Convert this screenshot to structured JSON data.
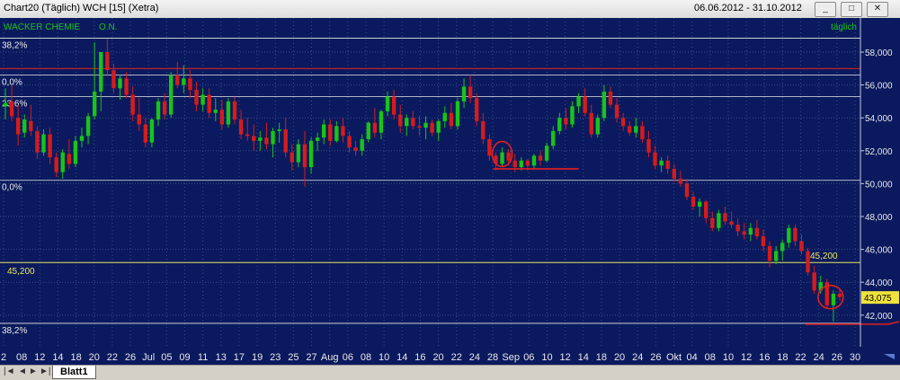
{
  "window": {
    "title": "Chart20 (Täglich)  WCH [15] (Xetra)",
    "date_range": "06.06.2012 - 31.10.2012"
  },
  "sheet_tab": "Blatt1",
  "colors": {
    "up": "#18c418",
    "down": "#d41c1c",
    "background": "#0b1a5e",
    "grid": "#3a4a8a",
    "fib": "#e8e8e8",
    "resistance": "#d42020",
    "support": "#e8e85a",
    "header_text": "#18c418"
  },
  "chart_data": {
    "type": "candlestick",
    "header_left": "WACKER CHEMIE",
    "header_mid": "O.N.",
    "header_right": "täglich",
    "ylim": [
      41.0,
      59.0
    ],
    "y_ticks": [
      "58,000",
      "56,000",
      "54,000",
      "52,000",
      "50,000",
      "48,000",
      "46,000",
      "44,000",
      "42,000"
    ],
    "last_price": "43,075",
    "x_labels": [
      "2",
      "08",
      "12",
      "14",
      "18",
      "20",
      "22",
      "26",
      "Jul",
      "05",
      "09",
      "11",
      "13",
      "17",
      "19",
      "23",
      "25",
      "27",
      "Aug",
      "06",
      "08",
      "10",
      "14",
      "16",
      "20",
      "22",
      "24",
      "28",
      "Sep",
      "06",
      "10",
      "12",
      "14",
      "18",
      "20",
      "24",
      "26",
      "Okt",
      "04",
      "08",
      "10",
      "12",
      "16",
      "18",
      "22",
      "24",
      "26",
      "30"
    ],
    "fib_lines": [
      {
        "value": 58.85,
        "label": "38,2%"
      },
      {
        "value": 56.6,
        "label": "0,0%"
      },
      {
        "value": 55.3,
        "label": "23,6%"
      },
      {
        "value": 50.2,
        "label": "0,0%"
      },
      {
        "value": 41.5,
        "label": "38,2%"
      }
    ],
    "resistance_line": 57.0,
    "support_line": {
      "value": 45.2,
      "label_left": "45,200",
      "label_right": "45,200"
    },
    "series": [
      {
        "o": 54.7,
        "h": 55.8,
        "l": 53.9,
        "c": 54.9
      },
      {
        "o": 55.0,
        "h": 56.0,
        "l": 53.8,
        "c": 54.1
      },
      {
        "o": 54.0,
        "h": 54.8,
        "l": 52.3,
        "c": 53.0
      },
      {
        "o": 53.1,
        "h": 54.2,
        "l": 52.8,
        "c": 53.9
      },
      {
        "o": 53.8,
        "h": 54.8,
        "l": 52.9,
        "c": 53.2
      },
      {
        "o": 53.2,
        "h": 53.5,
        "l": 51.5,
        "c": 51.9
      },
      {
        "o": 51.9,
        "h": 53.3,
        "l": 51.7,
        "c": 53.0
      },
      {
        "o": 53.0,
        "h": 53.4,
        "l": 51.2,
        "c": 51.6
      },
      {
        "o": 51.6,
        "h": 51.9,
        "l": 50.4,
        "c": 50.7
      },
      {
        "o": 50.7,
        "h": 52.1,
        "l": 50.3,
        "c": 51.9
      },
      {
        "o": 51.8,
        "h": 52.7,
        "l": 50.9,
        "c": 51.2
      },
      {
        "o": 51.2,
        "h": 52.9,
        "l": 51.0,
        "c": 52.6
      },
      {
        "o": 52.6,
        "h": 53.4,
        "l": 52.2,
        "c": 52.9
      },
      {
        "o": 52.9,
        "h": 54.3,
        "l": 52.4,
        "c": 54.1
      },
      {
        "o": 54.1,
        "h": 58.6,
        "l": 53.9,
        "c": 55.6
      },
      {
        "o": 55.6,
        "h": 58.0,
        "l": 54.4,
        "c": 58.0
      },
      {
        "o": 58.0,
        "h": 58.8,
        "l": 56.5,
        "c": 56.9
      },
      {
        "o": 56.9,
        "h": 57.3,
        "l": 55.5,
        "c": 55.8
      },
      {
        "o": 55.8,
        "h": 56.6,
        "l": 55.1,
        "c": 56.4
      },
      {
        "o": 56.4,
        "h": 56.8,
        "l": 55.2,
        "c": 55.4
      },
      {
        "o": 55.4,
        "h": 55.9,
        "l": 53.8,
        "c": 54.2
      },
      {
        "o": 54.2,
        "h": 55.2,
        "l": 53.2,
        "c": 53.6
      },
      {
        "o": 53.6,
        "h": 54.0,
        "l": 52.2,
        "c": 52.5
      },
      {
        "o": 52.5,
        "h": 54.0,
        "l": 52.2,
        "c": 53.9
      },
      {
        "o": 53.9,
        "h": 55.2,
        "l": 53.5,
        "c": 55.0
      },
      {
        "o": 55.0,
        "h": 55.5,
        "l": 53.9,
        "c": 54.2
      },
      {
        "o": 54.2,
        "h": 56.8,
        "l": 54.0,
        "c": 56.6
      },
      {
        "o": 56.6,
        "h": 57.4,
        "l": 55.8,
        "c": 56.0
      },
      {
        "o": 56.0,
        "h": 57.2,
        "l": 55.5,
        "c": 56.4
      },
      {
        "o": 56.4,
        "h": 56.9,
        "l": 55.2,
        "c": 55.7
      },
      {
        "o": 55.7,
        "h": 56.2,
        "l": 54.4,
        "c": 54.8
      },
      {
        "o": 54.8,
        "h": 55.8,
        "l": 54.4,
        "c": 55.4
      },
      {
        "o": 55.4,
        "h": 55.8,
        "l": 54.0,
        "c": 54.3
      },
      {
        "o": 54.3,
        "h": 55.2,
        "l": 53.8,
        "c": 54.5
      },
      {
        "o": 54.5,
        "h": 55.1,
        "l": 53.3,
        "c": 53.6
      },
      {
        "o": 53.6,
        "h": 55.2,
        "l": 53.4,
        "c": 55.0
      },
      {
        "o": 55.0,
        "h": 55.3,
        "l": 53.6,
        "c": 53.9
      },
      {
        "o": 53.9,
        "h": 54.5,
        "l": 52.7,
        "c": 53.0
      },
      {
        "o": 53.0,
        "h": 54.0,
        "l": 52.6,
        "c": 52.9
      },
      {
        "o": 52.9,
        "h": 53.6,
        "l": 52.0,
        "c": 52.6
      },
      {
        "o": 52.6,
        "h": 53.2,
        "l": 52.0,
        "c": 52.8
      },
      {
        "o": 52.8,
        "h": 53.7,
        "l": 52.1,
        "c": 52.4
      },
      {
        "o": 52.4,
        "h": 53.4,
        "l": 51.6,
        "c": 53.2
      },
      {
        "o": 53.2,
        "h": 53.7,
        "l": 52.5,
        "c": 53.3
      },
      {
        "o": 53.3,
        "h": 54.0,
        "l": 51.6,
        "c": 51.9
      },
      {
        "o": 51.9,
        "h": 52.4,
        "l": 50.8,
        "c": 51.3
      },
      {
        "o": 51.3,
        "h": 52.7,
        "l": 51.0,
        "c": 52.4
      },
      {
        "o": 52.4,
        "h": 53.2,
        "l": 49.8,
        "c": 51.0
      },
      {
        "o": 51.0,
        "h": 52.8,
        "l": 50.6,
        "c": 52.6
      },
      {
        "o": 52.6,
        "h": 53.1,
        "l": 52.0,
        "c": 52.8
      },
      {
        "o": 52.8,
        "h": 53.9,
        "l": 52.4,
        "c": 53.6
      },
      {
        "o": 53.6,
        "h": 53.9,
        "l": 52.3,
        "c": 52.6
      },
      {
        "o": 52.6,
        "h": 53.8,
        "l": 52.5,
        "c": 53.5
      },
      {
        "o": 53.5,
        "h": 54.0,
        "l": 52.5,
        "c": 52.9
      },
      {
        "o": 52.9,
        "h": 53.2,
        "l": 51.9,
        "c": 52.2
      },
      {
        "o": 52.2,
        "h": 52.6,
        "l": 51.7,
        "c": 52.0
      },
      {
        "o": 52.0,
        "h": 53.0,
        "l": 51.7,
        "c": 52.7
      },
      {
        "o": 52.7,
        "h": 53.8,
        "l": 52.5,
        "c": 53.7
      },
      {
        "o": 53.7,
        "h": 54.6,
        "l": 52.8,
        "c": 53.1
      },
      {
        "o": 53.1,
        "h": 54.5,
        "l": 52.7,
        "c": 54.4
      },
      {
        "o": 54.4,
        "h": 55.6,
        "l": 54.1,
        "c": 55.3
      },
      {
        "o": 55.3,
        "h": 55.7,
        "l": 53.9,
        "c": 54.2
      },
      {
        "o": 54.2,
        "h": 54.8,
        "l": 53.1,
        "c": 53.5
      },
      {
        "o": 53.5,
        "h": 54.2,
        "l": 52.9,
        "c": 54.0
      },
      {
        "o": 54.0,
        "h": 54.4,
        "l": 53.3,
        "c": 53.5
      },
      {
        "o": 53.5,
        "h": 54.1,
        "l": 52.9,
        "c": 53.4
      },
      {
        "o": 53.4,
        "h": 54.1,
        "l": 52.7,
        "c": 53.7
      },
      {
        "o": 53.7,
        "h": 53.9,
        "l": 52.9,
        "c": 53.1
      },
      {
        "o": 53.1,
        "h": 53.9,
        "l": 52.6,
        "c": 53.8
      },
      {
        "o": 53.8,
        "h": 54.7,
        "l": 53.4,
        "c": 54.3
      },
      {
        "o": 54.3,
        "h": 54.9,
        "l": 53.3,
        "c": 53.5
      },
      {
        "o": 53.5,
        "h": 55.2,
        "l": 53.3,
        "c": 55.0
      },
      {
        "o": 55.0,
        "h": 56.4,
        "l": 54.6,
        "c": 55.9
      },
      {
        "o": 55.9,
        "h": 56.6,
        "l": 54.9,
        "c": 55.2
      },
      {
        "o": 55.2,
        "h": 55.5,
        "l": 53.5,
        "c": 53.8
      },
      {
        "o": 53.8,
        "h": 54.3,
        "l": 52.4,
        "c": 52.7
      },
      {
        "o": 52.7,
        "h": 53.0,
        "l": 51.4,
        "c": 51.7
      },
      {
        "o": 51.7,
        "h": 51.9,
        "l": 50.8,
        "c": 51.2
      },
      {
        "o": 51.2,
        "h": 52.2,
        "l": 51.0,
        "c": 51.9
      },
      {
        "o": 51.9,
        "h": 52.1,
        "l": 51.1,
        "c": 51.4
      },
      {
        "o": 51.4,
        "h": 51.8,
        "l": 50.7,
        "c": 51.0
      },
      {
        "o": 51.0,
        "h": 51.6,
        "l": 50.8,
        "c": 51.4
      },
      {
        "o": 51.4,
        "h": 51.5,
        "l": 50.8,
        "c": 51.1
      },
      {
        "o": 51.1,
        "h": 51.8,
        "l": 50.9,
        "c": 51.7
      },
      {
        "o": 51.7,
        "h": 52.0,
        "l": 51.1,
        "c": 51.4
      },
      {
        "o": 51.4,
        "h": 52.5,
        "l": 51.3,
        "c": 52.3
      },
      {
        "o": 52.3,
        "h": 53.5,
        "l": 52.1,
        "c": 53.2
      },
      {
        "o": 53.2,
        "h": 54.3,
        "l": 53.0,
        "c": 54.0
      },
      {
        "o": 54.0,
        "h": 54.6,
        "l": 53.3,
        "c": 53.6
      },
      {
        "o": 53.6,
        "h": 55.0,
        "l": 53.4,
        "c": 54.7
      },
      {
        "o": 54.7,
        "h": 55.5,
        "l": 54.3,
        "c": 55.3
      },
      {
        "o": 55.3,
        "h": 55.8,
        "l": 54.1,
        "c": 54.3
      },
      {
        "o": 54.3,
        "h": 54.8,
        "l": 52.8,
        "c": 53.0
      },
      {
        "o": 53.0,
        "h": 54.2,
        "l": 52.8,
        "c": 54.0
      },
      {
        "o": 54.0,
        "h": 56.0,
        "l": 53.8,
        "c": 55.6
      },
      {
        "o": 55.6,
        "h": 55.9,
        "l": 54.6,
        "c": 54.8
      },
      {
        "o": 54.8,
        "h": 55.2,
        "l": 53.7,
        "c": 54.0
      },
      {
        "o": 54.0,
        "h": 54.3,
        "l": 53.2,
        "c": 53.5
      },
      {
        "o": 53.5,
        "h": 53.8,
        "l": 52.9,
        "c": 53.1
      },
      {
        "o": 53.1,
        "h": 54.0,
        "l": 52.8,
        "c": 53.5
      },
      {
        "o": 53.5,
        "h": 53.8,
        "l": 52.5,
        "c": 52.7
      },
      {
        "o": 52.7,
        "h": 53.2,
        "l": 51.6,
        "c": 51.9
      },
      {
        "o": 51.9,
        "h": 52.3,
        "l": 50.9,
        "c": 51.1
      },
      {
        "o": 51.1,
        "h": 51.6,
        "l": 50.7,
        "c": 51.4
      },
      {
        "o": 51.4,
        "h": 51.7,
        "l": 50.6,
        "c": 50.9
      },
      {
        "o": 50.9,
        "h": 51.2,
        "l": 50.1,
        "c": 50.3
      },
      {
        "o": 50.3,
        "h": 50.8,
        "l": 49.8,
        "c": 50.0
      },
      {
        "o": 50.0,
        "h": 50.3,
        "l": 49.0,
        "c": 49.2
      },
      {
        "o": 49.2,
        "h": 49.5,
        "l": 48.4,
        "c": 48.6
      },
      {
        "o": 48.6,
        "h": 49.1,
        "l": 48.0,
        "c": 48.9
      },
      {
        "o": 48.9,
        "h": 49.0,
        "l": 47.6,
        "c": 47.9
      },
      {
        "o": 47.9,
        "h": 48.3,
        "l": 47.1,
        "c": 47.3
      },
      {
        "o": 47.3,
        "h": 48.4,
        "l": 47.1,
        "c": 48.2
      },
      {
        "o": 48.2,
        "h": 48.6,
        "l": 47.5,
        "c": 47.7
      },
      {
        "o": 47.7,
        "h": 48.3,
        "l": 47.3,
        "c": 47.5
      },
      {
        "o": 47.5,
        "h": 47.9,
        "l": 46.8,
        "c": 47.1
      },
      {
        "o": 47.1,
        "h": 47.6,
        "l": 46.6,
        "c": 46.9
      },
      {
        "o": 46.9,
        "h": 47.6,
        "l": 46.5,
        "c": 47.3
      },
      {
        "o": 47.3,
        "h": 47.8,
        "l": 46.6,
        "c": 46.8
      },
      {
        "o": 46.8,
        "h": 47.2,
        "l": 45.9,
        "c": 46.2
      },
      {
        "o": 46.2,
        "h": 46.5,
        "l": 44.9,
        "c": 45.3
      },
      {
        "o": 45.3,
        "h": 46.2,
        "l": 45.1,
        "c": 45.9
      },
      {
        "o": 45.9,
        "h": 46.6,
        "l": 45.3,
        "c": 46.4
      },
      {
        "o": 46.4,
        "h": 47.5,
        "l": 46.1,
        "c": 47.3
      },
      {
        "o": 47.3,
        "h": 47.5,
        "l": 46.2,
        "c": 46.5
      },
      {
        "o": 46.5,
        "h": 46.9,
        "l": 45.7,
        "c": 45.9
      },
      {
        "o": 45.9,
        "h": 46.1,
        "l": 44.4,
        "c": 44.6
      },
      {
        "o": 44.6,
        "h": 45.0,
        "l": 43.3,
        "c": 43.5
      },
      {
        "o": 43.5,
        "h": 44.4,
        "l": 43.3,
        "c": 44.0
      },
      {
        "o": 44.0,
        "h": 44.2,
        "l": 42.4,
        "c": 42.6
      },
      {
        "o": 42.6,
        "h": 43.5,
        "l": 41.6,
        "c": 43.3
      },
      {
        "o": 43.3,
        "h": 43.6,
        "l": 42.9,
        "c": 43.1
      }
    ]
  }
}
